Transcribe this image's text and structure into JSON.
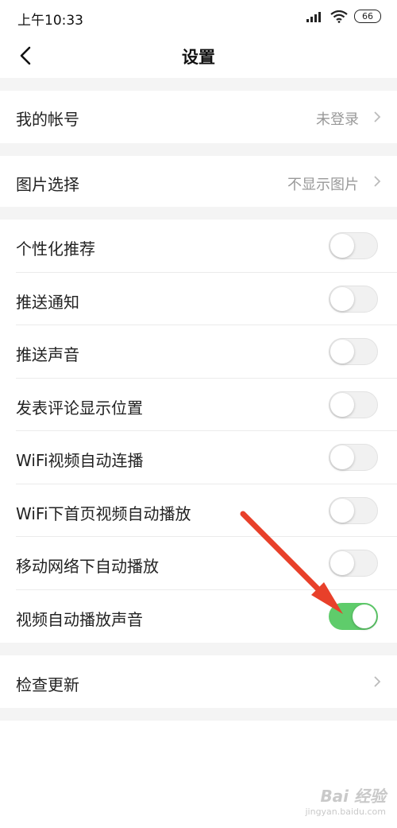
{
  "status_bar": {
    "time": "上午10:33",
    "battery": "66"
  },
  "nav": {
    "title": "设置"
  },
  "account": {
    "label": "我的帐号",
    "value": "未登录"
  },
  "image_select": {
    "label": "图片选择",
    "value": "不显示图片"
  },
  "toggles": [
    {
      "label": "个性化推荐",
      "on": false
    },
    {
      "label": "推送通知",
      "on": false
    },
    {
      "label": "推送声音",
      "on": false
    },
    {
      "label": "发表评论显示位置",
      "on": false
    },
    {
      "label": "WiFi视频自动连播",
      "on": false
    },
    {
      "label": "WiFi下首页视频自动播放",
      "on": false
    },
    {
      "label": "移动网络下自动播放",
      "on": false
    },
    {
      "label": "视频自动播放声音",
      "on": true
    }
  ],
  "check_update": {
    "label": "检查更新"
  },
  "watermark": {
    "logo": "Bai 经验",
    "url": "jingyan.baidu.com"
  },
  "colors": {
    "toggle_on": "#5fcc6b",
    "arrow": "#e8402a",
    "section_gap": "#f4f4f4"
  }
}
